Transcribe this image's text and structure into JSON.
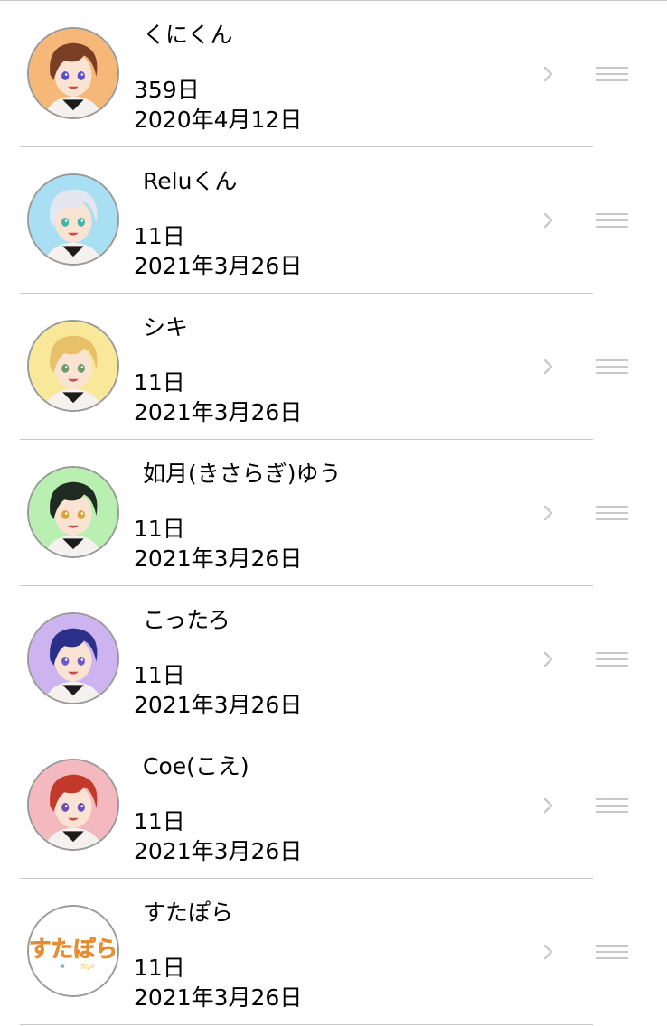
{
  "rows": [
    {
      "name": "くにくん",
      "days": "359日",
      "date": "2020年4月12日",
      "bg": "#f6b878",
      "hair": "#7a3e24",
      "eyes": "#5a4fc8"
    },
    {
      "name": "Reluくん",
      "days": "11日",
      "date": "2021年3月26日",
      "bg": "#a8dff2",
      "hair": "#e4e6f0",
      "eyes": "#3fb6a8"
    },
    {
      "name": "シキ",
      "days": "11日",
      "date": "2021年3月26日",
      "bg": "#f9e79a",
      "hair": "#e8c06a",
      "eyes": "#6f9a6a"
    },
    {
      "name": "如月(きさらぎ)ゆう",
      "days": "11日",
      "date": "2021年3月26日",
      "bg": "#b9efb0",
      "hair": "#1e2a22",
      "eyes": "#d8a43a"
    },
    {
      "name": "こったろ",
      "days": "11日",
      "date": "2021年3月26日",
      "bg": "#cdb4f0",
      "hair": "#2a2f8a",
      "eyes": "#6a5ac8"
    },
    {
      "name": "Coe(こえ)",
      "days": "11日",
      "date": "2021年3月26日",
      "bg": "#f4b8bf",
      "hair": "#c0392b",
      "eyes": "#6a4fb8"
    },
    {
      "name": "すたぽら",
      "days": "11日",
      "date": "2021年3月26日",
      "bg": "#ffffff",
      "logo_text": "すたぽら",
      "logo_sub": "Stpl"
    }
  ],
  "colors": {
    "separator": "#c8c7cc",
    "chevron": "#c7c7cc",
    "reorder": "#c7c7cc"
  },
  "icons": {
    "chevron": "chevron-right-icon",
    "reorder": "reorder-handle-icon"
  }
}
